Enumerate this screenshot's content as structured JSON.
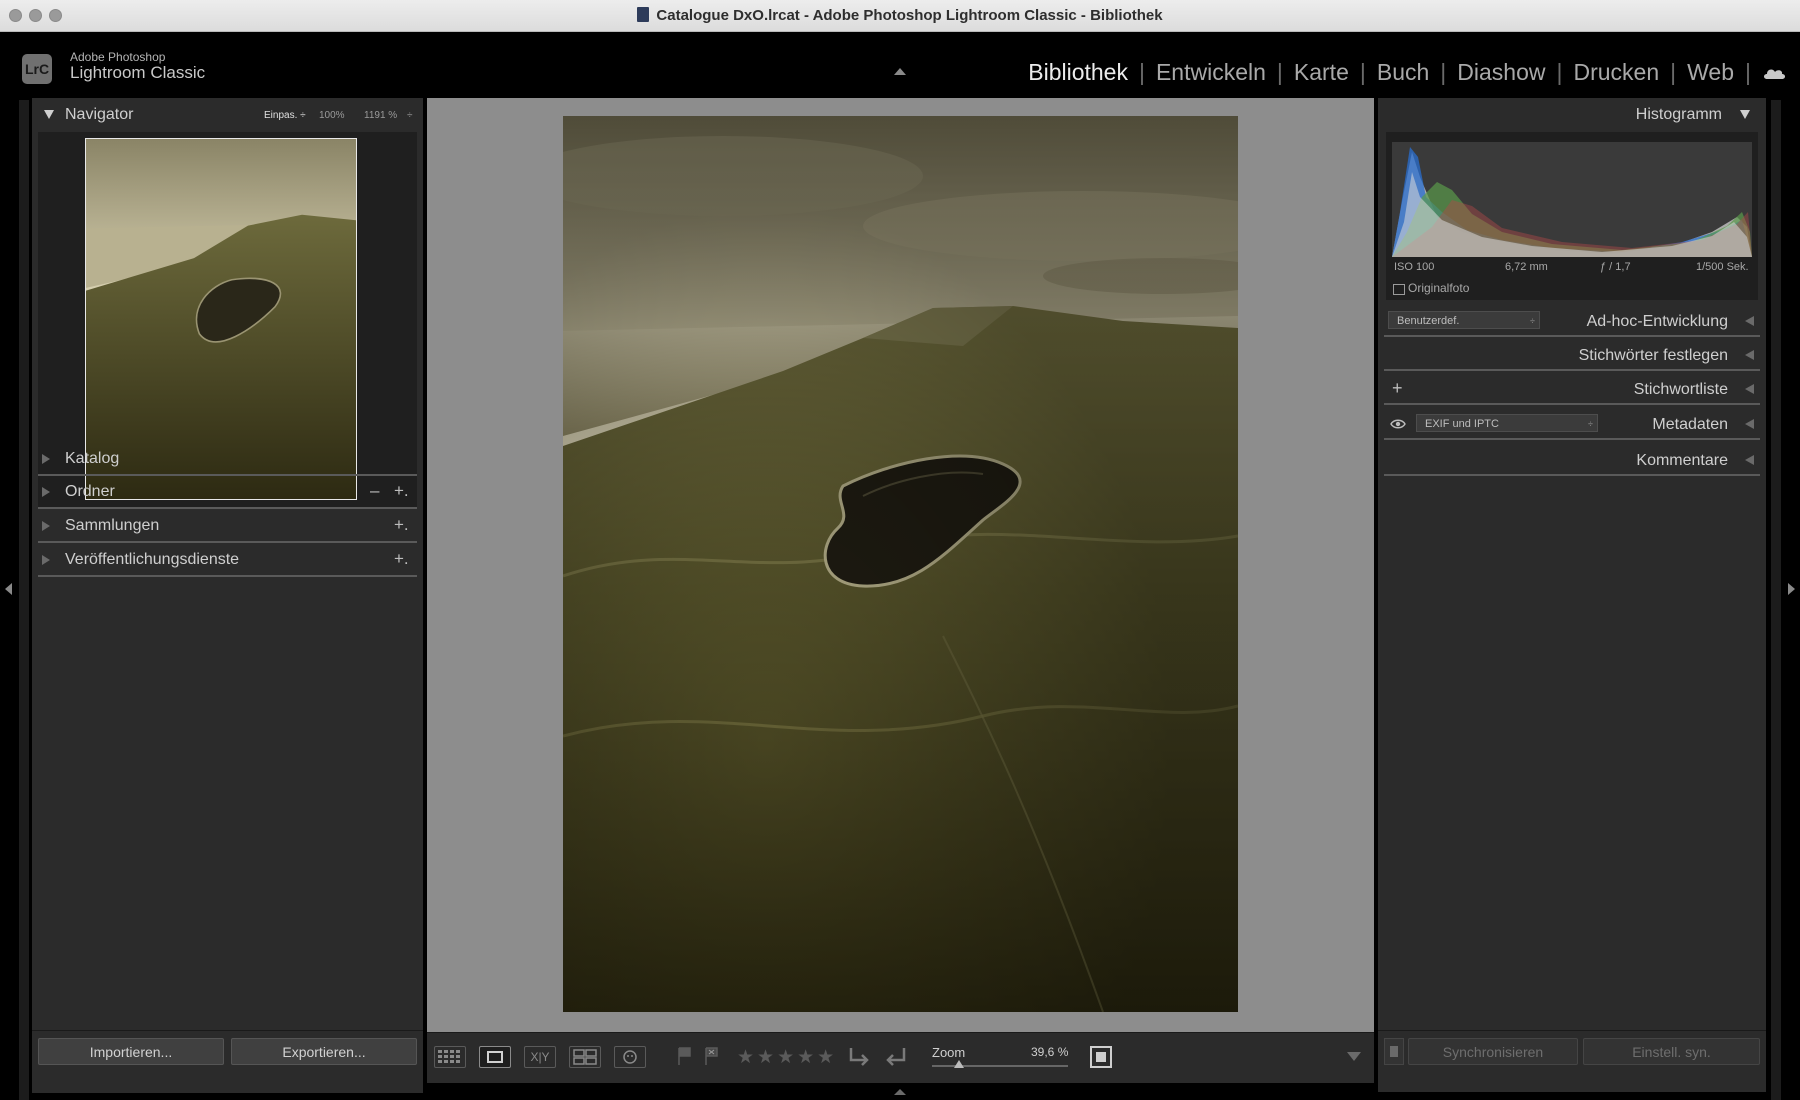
{
  "window": {
    "title": "Catalogue DxO.lrcat - Adobe Photoshop Lightroom Classic - Bibliothek"
  },
  "brand": {
    "logo": "LrC",
    "line1": "Adobe Photoshop",
    "line2": "Lightroom Classic"
  },
  "modules": [
    {
      "label": "Bibliothek",
      "active": true
    },
    {
      "label": "Entwickeln",
      "active": false
    },
    {
      "label": "Karte",
      "active": false
    },
    {
      "label": "Buch",
      "active": false
    },
    {
      "label": "Diashow",
      "active": false
    },
    {
      "label": "Drucken",
      "active": false
    },
    {
      "label": "Web",
      "active": false
    }
  ],
  "left_panel": {
    "navigator": {
      "title": "Navigator",
      "zoom_fit": "Einpas. ÷",
      "zoom_100": "100%",
      "zoom_custom": "1191 %"
    },
    "sections": [
      {
        "label": "Katalog"
      },
      {
        "label": "Ordner",
        "minus": "–",
        "plus": "+."
      },
      {
        "label": "Sammlungen",
        "plus": "+."
      },
      {
        "label": "Veröffentlichungsdienste",
        "plus": "+."
      }
    ],
    "import_label": "Importieren...",
    "export_label": "Exportieren..."
  },
  "toolbar": {
    "zoom_label": "Zoom",
    "zoom_value": "39,6 %",
    "zoom_fraction": 0.2,
    "rating_stars": "★★★★★",
    "compare_label": "X|Y"
  },
  "right_panel": {
    "histogram": {
      "title": "Histogramm",
      "iso": "ISO 100",
      "focal": "6,72 mm",
      "aperture": "ƒ / 1,7",
      "shutter": "1/500 Sek.",
      "original_label": "Originalfoto"
    },
    "quick_develop": {
      "preset": "Benutzerdef.",
      "title": "Ad-hoc-Entwicklung"
    },
    "keywording": {
      "title": "Stichwörter festlegen"
    },
    "keyword_list": {
      "plus": "+",
      "title": "Stichwortliste"
    },
    "metadata": {
      "preset": "EXIF und IPTC",
      "title": "Metadaten"
    },
    "comments": {
      "title": "Kommentare"
    },
    "sync_label": "Synchronisieren",
    "sync_settings_label": "Einstell. syn."
  },
  "colors": {
    "panel_bg": "#2b2b2b",
    "canvas_bg": "#8d8d8d",
    "active_module": "#ececec",
    "histo_blue": "#2a6fd1",
    "histo_green": "#5a9a4a",
    "histo_red": "#b04a4a"
  }
}
